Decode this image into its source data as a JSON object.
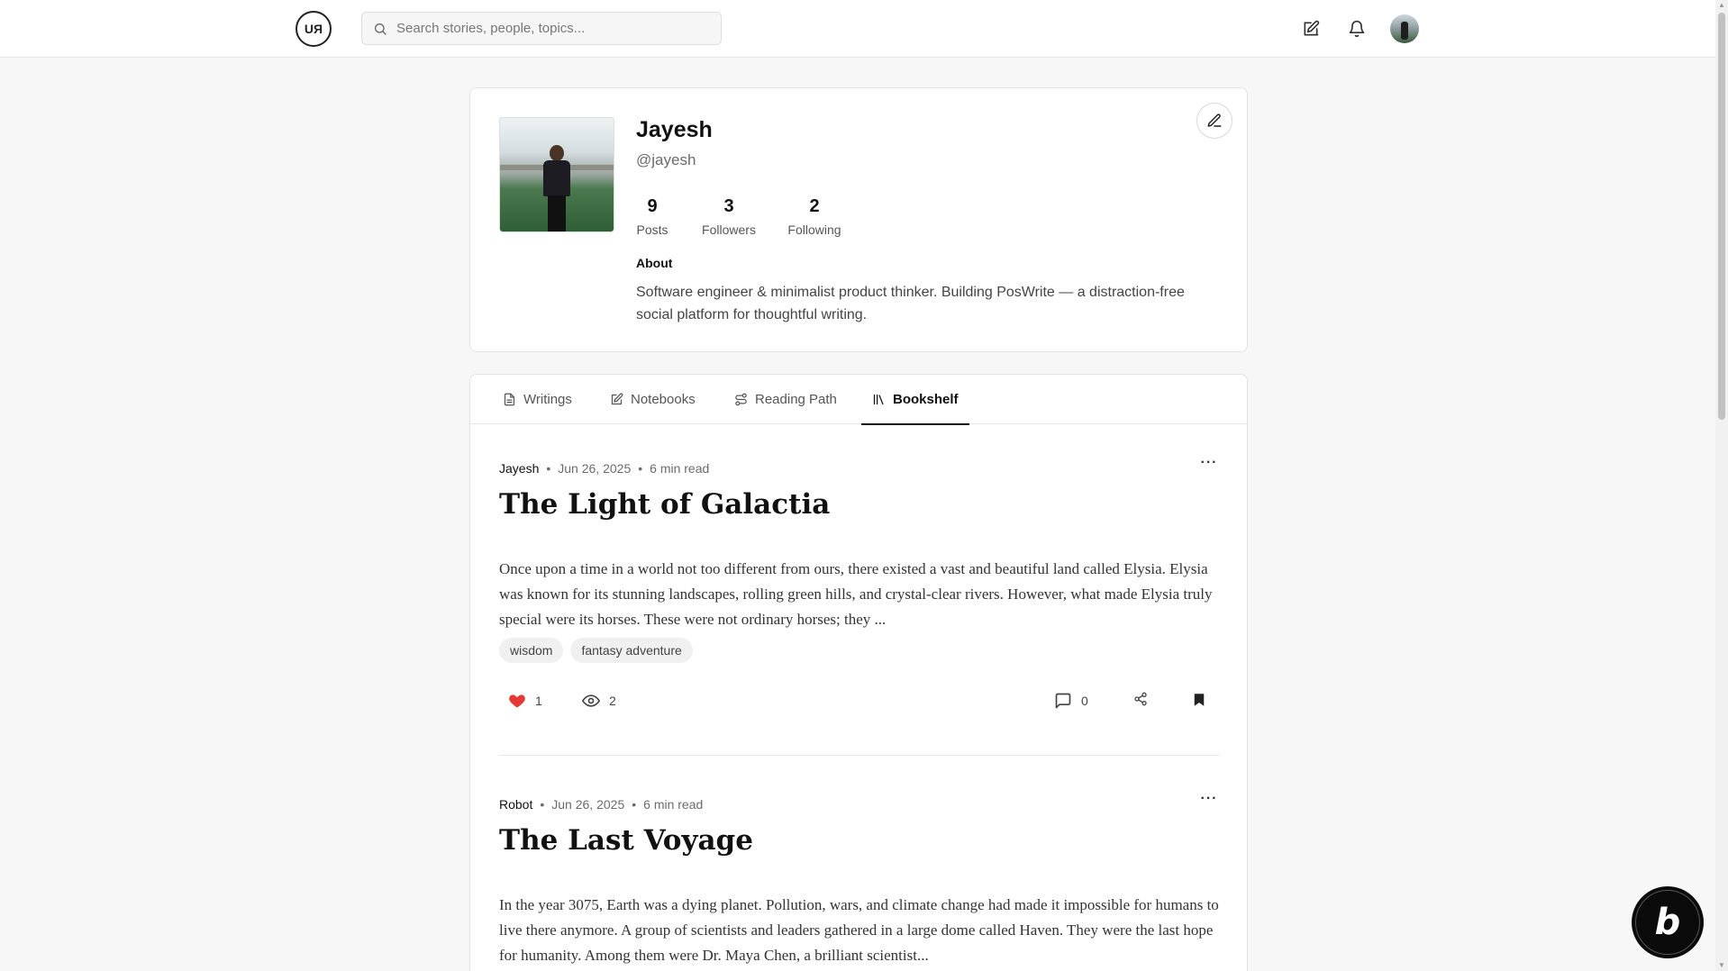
{
  "topbar": {
    "logo_text": "UЯ",
    "search_placeholder": "Search stories, people, topics...",
    "icons": [
      "edit-icon",
      "bell-icon",
      "avatar"
    ]
  },
  "profile": {
    "name": "Jayesh",
    "handle": "@jayesh",
    "stats": [
      {
        "value": "9",
        "label": "Posts"
      },
      {
        "value": "3",
        "label": "Followers"
      },
      {
        "value": "2",
        "label": "Following"
      }
    ],
    "about_heading": "About",
    "about_text": "Software engineer & minimalist product thinker. Building PosWrite — a distraction-free social platform for thoughtful writing."
  },
  "tabs": [
    {
      "label": "Writings",
      "icon": "document-icon",
      "active": false
    },
    {
      "label": "Notebooks",
      "icon": "notebook-edit-icon",
      "active": false
    },
    {
      "label": "Reading Path",
      "icon": "path-icon",
      "active": false
    },
    {
      "label": "Bookshelf",
      "icon": "library-icon",
      "active": true
    }
  ],
  "posts": [
    {
      "author": "Jayesh",
      "date": "Jun 26, 2025",
      "read_time": "6 min read",
      "title": "The Light of Galactia",
      "excerpt": "Once upon a time in a world not too different from ours, there existed a vast and beautiful land called Elysia. Elysia was known for its stunning landscapes, rolling green hills, and crystal-clear rivers. However, what made Elysia truly special were its horses. These were not ordinary horses; they ...",
      "tags": [
        "wisdom",
        "fantasy adventure"
      ],
      "likes": "1",
      "views": "2",
      "comments": "0"
    },
    {
      "author": "Robot",
      "date": "Jun 26, 2025",
      "read_time": "6 min read",
      "title": "The Last Voyage",
      "excerpt": "In the year 3075, Earth was a dying planet. Pollution, wars, and climate change had made it impossible for humans to live there anymore. A group of scientists and leaders gathered in a large dome called Haven. They were the last hope for humanity. Among them were Dr. Maya Chen, a brilliant scientist..."
    }
  ],
  "colors": {
    "like": "#e53935",
    "accent": "#111111",
    "background": "#f7f7f7"
  },
  "badge": {
    "letter": "b"
  }
}
